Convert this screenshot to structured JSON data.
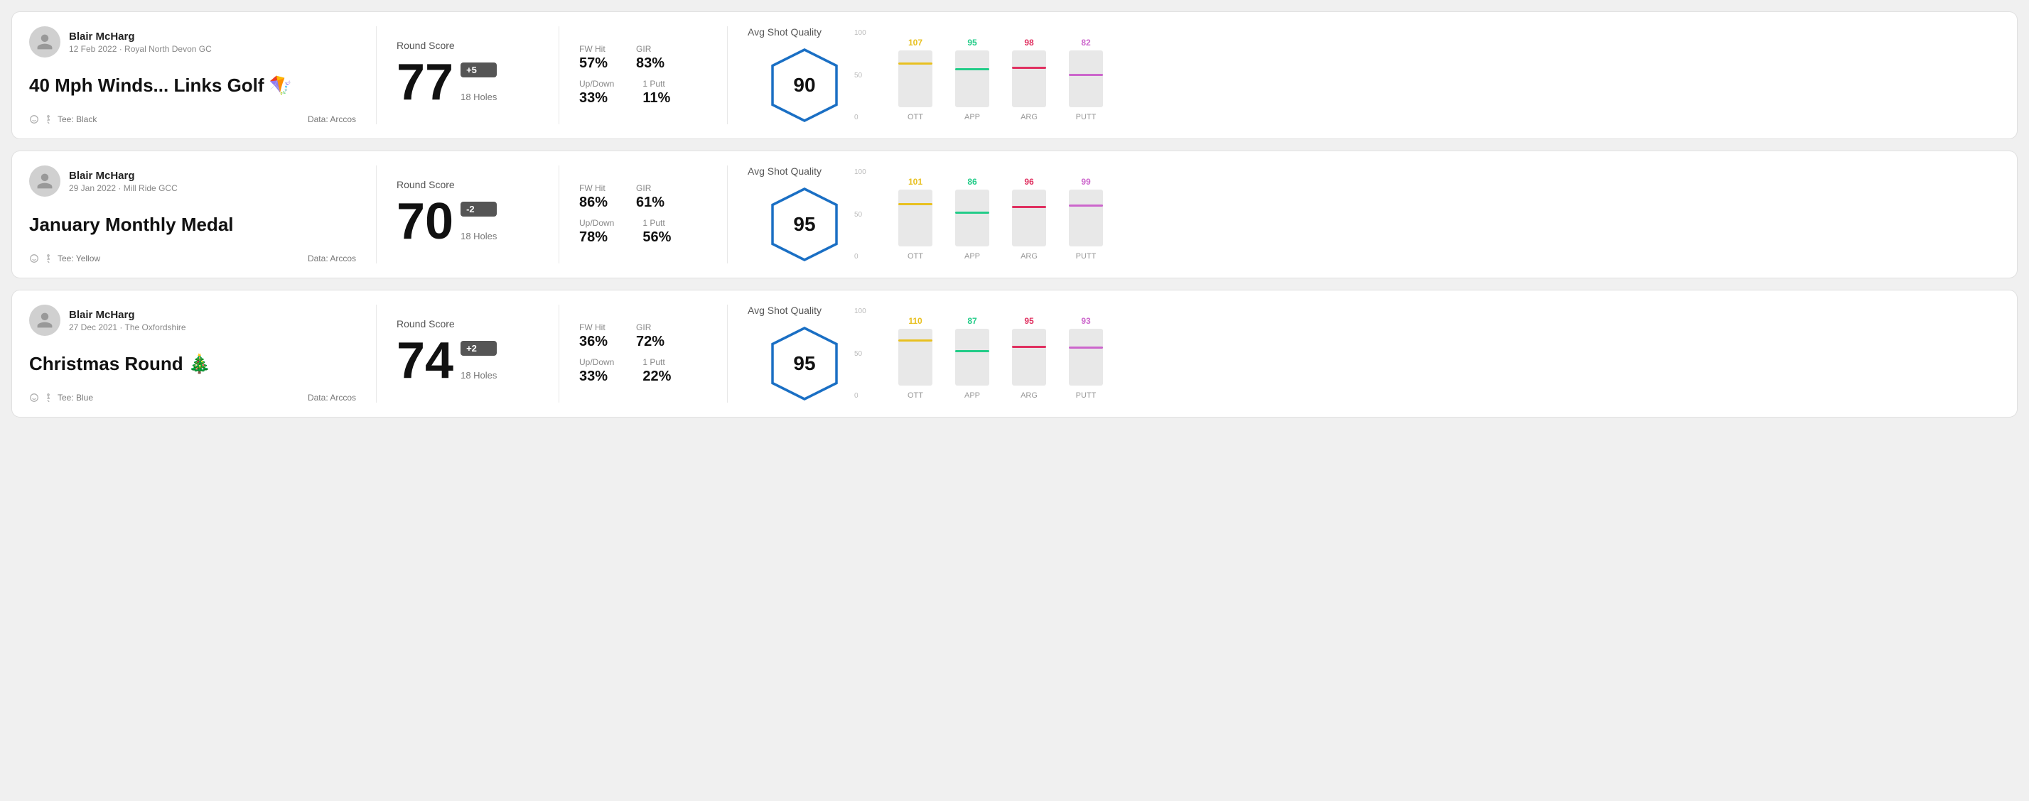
{
  "rounds": [
    {
      "id": "round1",
      "user": {
        "name": "Blair McHarg",
        "meta": "12 Feb 2022 · Royal North Devon GC"
      },
      "title": "40 Mph Winds... Links Golf 🪁",
      "tee": "Tee: Black",
      "data_source": "Data: Arccos",
      "score": {
        "label": "Round Score",
        "value": "77",
        "badge": "+5",
        "holes": "18 Holes"
      },
      "stats": {
        "fw_hit_label": "FW Hit",
        "fw_hit_value": "57%",
        "gir_label": "GIR",
        "gir_value": "83%",
        "updown_label": "Up/Down",
        "updown_value": "33%",
        "one_putt_label": "1 Putt",
        "one_putt_value": "11%"
      },
      "quality": {
        "label": "Avg Shot Quality",
        "value": "90"
      },
      "chart": {
        "bars": [
          {
            "label": "OTT",
            "value": 107,
            "color": "#e8c020",
            "pct": 75
          },
          {
            "label": "APP",
            "value": 95,
            "color": "#22cc88",
            "pct": 65
          },
          {
            "label": "ARG",
            "value": 98,
            "color": "#e03060",
            "pct": 68
          },
          {
            "label": "PUTT",
            "value": 82,
            "color": "#cc66cc",
            "pct": 55
          }
        ]
      }
    },
    {
      "id": "round2",
      "user": {
        "name": "Blair McHarg",
        "meta": "29 Jan 2022 · Mill Ride GCC"
      },
      "title": "January Monthly Medal",
      "tee": "Tee: Yellow",
      "data_source": "Data: Arccos",
      "score": {
        "label": "Round Score",
        "value": "70",
        "badge": "-2",
        "holes": "18 Holes"
      },
      "stats": {
        "fw_hit_label": "FW Hit",
        "fw_hit_value": "86%",
        "gir_label": "GIR",
        "gir_value": "61%",
        "updown_label": "Up/Down",
        "updown_value": "78%",
        "one_putt_label": "1 Putt",
        "one_putt_value": "56%"
      },
      "quality": {
        "label": "Avg Shot Quality",
        "value": "95"
      },
      "chart": {
        "bars": [
          {
            "label": "OTT",
            "value": 101,
            "color": "#e8c020",
            "pct": 72
          },
          {
            "label": "APP",
            "value": 86,
            "color": "#22cc88",
            "pct": 58
          },
          {
            "label": "ARG",
            "value": 96,
            "color": "#e03060",
            "pct": 67
          },
          {
            "label": "PUTT",
            "value": 99,
            "color": "#cc66cc",
            "pct": 70
          }
        ]
      }
    },
    {
      "id": "round3",
      "user": {
        "name": "Blair McHarg",
        "meta": "27 Dec 2021 · The Oxfordshire"
      },
      "title": "Christmas Round 🎄",
      "tee": "Tee: Blue",
      "data_source": "Data: Arccos",
      "score": {
        "label": "Round Score",
        "value": "74",
        "badge": "+2",
        "holes": "18 Holes"
      },
      "stats": {
        "fw_hit_label": "FW Hit",
        "fw_hit_value": "36%",
        "gir_label": "GIR",
        "gir_value": "72%",
        "updown_label": "Up/Down",
        "updown_value": "33%",
        "one_putt_label": "1 Putt",
        "one_putt_value": "22%"
      },
      "quality": {
        "label": "Avg Shot Quality",
        "value": "95"
      },
      "chart": {
        "bars": [
          {
            "label": "OTT",
            "value": 110,
            "color": "#e8c020",
            "pct": 78
          },
          {
            "label": "APP",
            "value": 87,
            "color": "#22cc88",
            "pct": 59
          },
          {
            "label": "ARG",
            "value": 95,
            "color": "#e03060",
            "pct": 66
          },
          {
            "label": "PUTT",
            "value": 93,
            "color": "#cc66cc",
            "pct": 65
          }
        ]
      }
    }
  ],
  "y_axis": [
    "100",
    "50",
    "0"
  ]
}
